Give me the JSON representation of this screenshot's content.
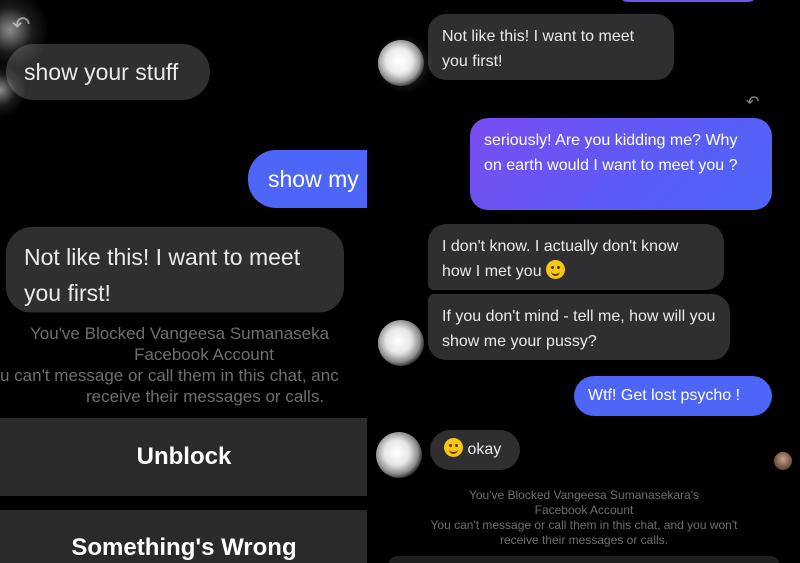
{
  "left": {
    "messages": {
      "show_stuff": "show your stuff",
      "show_my": "show my",
      "not_like_this": "Not like this! I want to meet you first!"
    },
    "blocked_notice": {
      "title": "You've Blocked Vangeesa Sumanaseka",
      "subtitle": "Facebook Account",
      "line1": "u can't message or call them in this chat, anc",
      "line2": "receive their messages or calls."
    },
    "actions": {
      "unblock": "Unblock",
      "something_wrong": "Something's Wrong"
    }
  },
  "right": {
    "messages": {
      "m1": "Not like this! I want to meet you first!",
      "m2": "seriously! Are you kidding me? Why on earth would I want to meet you ?",
      "m3": "I don't know. I actually don't know how I met you",
      "m4": "If you don't mind - tell me, how will you show me your pussy?",
      "m5": "Wtf! Get lost psycho !",
      "m6": "okay"
    },
    "blocked_notice": {
      "title": "You've Blocked Vangeesa Sumanasekara's",
      "subtitle": "Facebook Account",
      "line1": "You can't message or call them in this chat, and you won't",
      "line2": "receive their messages or calls."
    }
  },
  "colors": {
    "background": "#000000",
    "bubble_gray": "#2f2f31",
    "bubble_blue": "#4d66f7",
    "bubble_purple": "#7a4cf0",
    "notice_text": "#6f6f73"
  },
  "icons": [
    "reply-icon",
    "slightly-smiling-emoji",
    "contact-avatar",
    "read-receipt-avatar"
  ]
}
